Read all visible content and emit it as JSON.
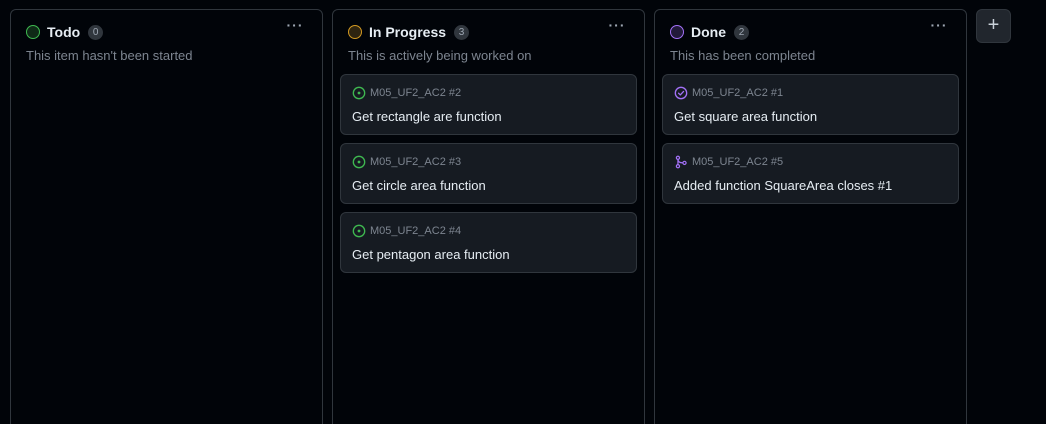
{
  "columns": [
    {
      "title": "Todo",
      "count": "0",
      "description": "This item hasn't been started",
      "status_color": "#3fb950",
      "menu_label": "···",
      "cards": []
    },
    {
      "title": "In Progress",
      "count": "3",
      "description": "This is actively being worked on",
      "status_color": "#d29922",
      "menu_label": "···",
      "cards": [
        {
          "ref": "M05_UF2_AC2 #2",
          "title": "Get rectangle are function",
          "icon": "issue-open-icon",
          "icon_color": "#3fb950"
        },
        {
          "ref": "M05_UF2_AC2 #3",
          "title": "Get circle area function",
          "icon": "issue-open-icon",
          "icon_color": "#3fb950"
        },
        {
          "ref": "M05_UF2_AC2 #4",
          "title": "Get pentagon area function",
          "icon": "issue-open-icon",
          "icon_color": "#3fb950"
        }
      ]
    },
    {
      "title": "Done",
      "count": "2",
      "description": "This has been completed",
      "status_color": "#a371f7",
      "menu_label": "···",
      "cards": [
        {
          "ref": "M05_UF2_AC2 #1",
          "title": "Get square area function",
          "icon": "issue-closed-icon",
          "icon_color": "#a371f7"
        },
        {
          "ref": "M05_UF2_AC2 #5",
          "title": "Added function SquareArea closes #1",
          "icon": "pull-request-merged-icon",
          "icon_color": "#a371f7"
        }
      ]
    }
  ],
  "add_column_label": "+"
}
